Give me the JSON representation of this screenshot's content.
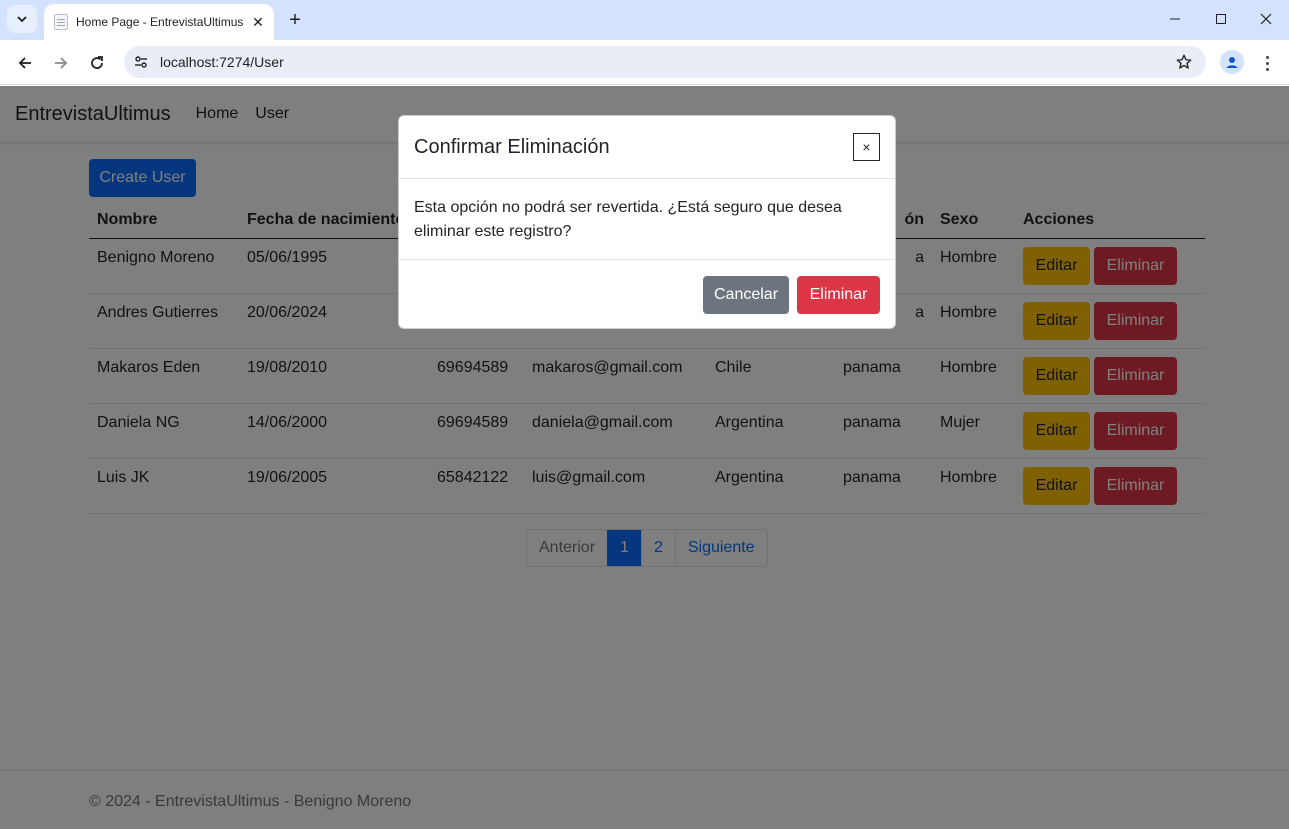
{
  "browser": {
    "tab_title": "Home Page - EntrevistaUltimus",
    "url": "localhost:7274/User"
  },
  "navbar": {
    "brand": "EntrevistaUltimus",
    "links": [
      "Home",
      "User"
    ]
  },
  "main": {
    "create_button": "Create User",
    "table": {
      "headers": [
        "Nombre",
        "Fecha de nacimiento",
        "",
        "",
        "",
        "ón",
        "Sexo",
        "Acciones"
      ],
      "rows": [
        {
          "nombre": "Benigno Moreno",
          "fecha": "05/06/1995",
          "telefono": "",
          "correo": "",
          "pais": "",
          "ciudad": "a",
          "sexo": "Hombre"
        },
        {
          "nombre": "Andres Gutierres",
          "fecha": "20/06/2024",
          "telefono": "",
          "correo": "",
          "pais": "",
          "ciudad": "a",
          "sexo": "Hombre"
        },
        {
          "nombre": "Makaros Eden",
          "fecha": "19/08/2010",
          "telefono": "69694589",
          "correo": "makaros@gmail.com",
          "pais": "Chile",
          "ciudad": "panama",
          "sexo": "Hombre"
        },
        {
          "nombre": "Daniela NG",
          "fecha": "14/06/2000",
          "telefono": "69694589",
          "correo": "daniela@gmail.com",
          "pais": "Argentina",
          "ciudad": "panama",
          "sexo": "Mujer"
        },
        {
          "nombre": "Luis JK",
          "fecha": "19/06/2005",
          "telefono": "65842122",
          "correo": "luis@gmail.com",
          "pais": "Argentina",
          "ciudad": "panama",
          "sexo": "Hombre"
        }
      ],
      "edit_label": "Editar",
      "delete_label": "Eliminar"
    },
    "pagination": {
      "prev": "Anterior",
      "pages": [
        "1",
        "2"
      ],
      "active_page": "1",
      "next": "Siguiente"
    }
  },
  "footer": {
    "text": "© 2024 - EntrevistaUltimus - Benigno Moreno"
  },
  "modal": {
    "title": "Confirmar Eliminación",
    "close": "×",
    "body": "Esta opción no podrá ser revertida. ¿Está seguro que desea eliminar este registro?",
    "cancel": "Cancelar",
    "confirm": "Eliminar"
  },
  "colors": {
    "primary": "#0d6efd",
    "warning": "#ffc107",
    "danger": "#dc3545",
    "secondary": "#6c757d",
    "tabbar": "#d3e3fd"
  }
}
